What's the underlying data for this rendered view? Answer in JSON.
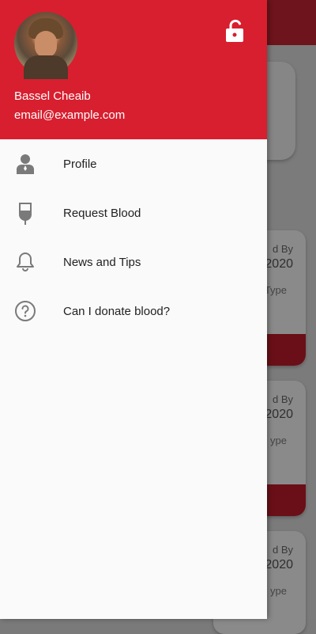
{
  "drawer": {
    "user": {
      "name": "Bassel Cheaib",
      "email": "email@example.com"
    },
    "items": [
      {
        "label": "Profile",
        "icon": "person-icon"
      },
      {
        "label": "Request Blood",
        "icon": "blood-bag-icon"
      },
      {
        "label": "News and Tips",
        "icon": "bell-icon"
      },
      {
        "label": "Can I donate blood?",
        "icon": "help-circle-icon"
      }
    ],
    "lock_icon": "lock-open-icon"
  },
  "background": {
    "cards": [
      {
        "label1": "d By",
        "label2": "2020",
        "label3": "Type"
      },
      {
        "label1": "d By",
        "label2": "2020",
        "label3": "ype"
      },
      {
        "label1": "d By",
        "label2": "2020",
        "label3": "ype"
      }
    ]
  },
  "colors": {
    "accent": "#d81f2f",
    "drawer_bg": "#fafafa",
    "text": "#222222"
  }
}
